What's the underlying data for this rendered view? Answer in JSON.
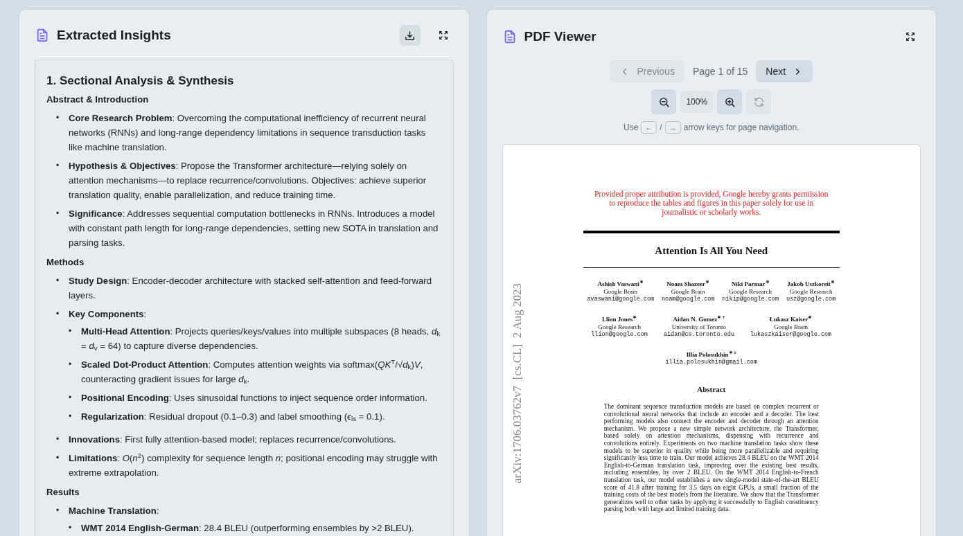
{
  "insights": {
    "title": "Extracted Insights",
    "heading": "1. Sectional Analysis & Synthesis",
    "groups": [
      {
        "title": "Abstract & Introduction",
        "items": [
          {
            "marker": "•",
            "text": "**Core Research Problem**: Overcoming the computational inefficiency of recurrent neural networks (RNNs) and long-range dependency limitations in sequence transduction tasks like machine translation."
          },
          {
            "marker": "•",
            "text": "**Hypothesis & Objectives**: Propose the Transformer architecture—relying solely on attention mechanisms—to replace recurrence/convolutions. Objectives: achieve superior translation quality, enable parallelization, and reduce training time."
          },
          {
            "marker": "•",
            "text": "**Significance**: Addresses sequential computation bottlenecks in RNNs. Introduces a model with constant path length for long-range dependencies, setting new SOTA in translation and parsing tasks."
          }
        ]
      },
      {
        "title": "Methods",
        "items": [
          {
            "marker": "•",
            "text": "**Study Design**: Encoder-decoder architecture with stacked self-attention and feed-forward layers."
          },
          {
            "marker": "•",
            "text": "**Key Components**:",
            "children": [
              {
                "marker": "•",
                "text": "**Multi-Head Attention**: Projects queries/keys/values into multiple subspaces (8 heads, *d*$_{k}$ = *d*$_{v}$ = 64) to capture diverse dependencies."
              },
              {
                "marker": "•",
                "text": "**Scaled Dot-Product Attention**: Computes attention weights via softmax(*QK*$^{T}$/√*d*$_{k}$)*V*, counteracting gradient issues for large *d*$_{k}$."
              },
              {
                "marker": "•",
                "text": "**Positional Encoding**: Uses sinusoidal functions to inject sequence order information."
              },
              {
                "marker": "•",
                "text": "**Regularization**: Residual dropout (0.1–0.3) and label smoothing (*ϵ*$_{ls}$ = 0.1)."
              }
            ]
          },
          {
            "marker": "•",
            "text": "**Innovations**: First fully attention-based model; replaces recurrence/convolutions."
          },
          {
            "marker": "•",
            "text": "**Limitations**: *O*(*n*$^{2}$) complexity for sequence length *n*; positional encoding may struggle with extreme extrapolation."
          }
        ]
      },
      {
        "title": "Results",
        "items": [
          {
            "marker": "•",
            "text": "**Machine Translation**:",
            "children": [
              {
                "marker": "•",
                "text": "**WMT 2014 English-German**: 28.4 BLEU (outperforming ensembles by >2 BLEU)."
              }
            ]
          }
        ]
      }
    ]
  },
  "viewer": {
    "title": "PDF Viewer",
    "previous": {
      "label": "Previous",
      "disabled": true
    },
    "page_indicator": "Page 1 of 15",
    "next": {
      "label": "Next",
      "disabled": false
    },
    "zoom_out": {
      "disabled": false
    },
    "zoom_level": "100%",
    "zoom_in": {
      "disabled": false
    },
    "reset": {
      "disabled": true
    },
    "hint": {
      "before": "Use",
      "keys": [
        "←",
        "→"
      ],
      "separator": "/",
      "after": "arrow keys for page navigation."
    },
    "paper": {
      "notice": "Provided proper attribution is provided, Google hereby grants permission to reproduce the tables and figures in this paper solely for use in journalistic or scholarly works.",
      "title": "Attention Is All You Need",
      "author_rows": [
        [
          {
            "name": "Ashish Vaswani$^{∗}$",
            "affiliation": "Google Brain",
            "email": "avaswani@google.com"
          },
          {
            "name": "Noam Shazeer$^{∗}$",
            "affiliation": "Google Brain",
            "email": "noam@google.com"
          },
          {
            "name": "Niki Parmar$^{∗}$",
            "affiliation": "Google Research",
            "email": "nikip@google.com"
          },
          {
            "name": "Jakob Uszkoreit$^{∗}$",
            "affiliation": "Google Research",
            "email": "usz@google.com"
          }
        ],
        [
          {
            "name": "Llion Jones$^{∗}$",
            "affiliation": "Google Research",
            "email": "llion@google.com"
          },
          {
            "name": "Aidan N. Gomez$^{∗ †}$",
            "affiliation": "University of Toronto",
            "email": "aidan@cs.toronto.edu"
          },
          {
            "name": "Łukasz Kaiser$^{∗}$",
            "affiliation": "Google Brain",
            "email": "lukaszkaiser@google.com"
          }
        ],
        [
          {
            "name": "Illia Polosukhin$^{∗ ‡}$",
            "email": "illia.polosukhin@gmail.com"
          }
        ]
      ],
      "abstract_title": "Abstract",
      "abstract": "The dominant sequence transduction models are based on complex recurrent or convolutional neural networks that include an encoder and a decoder. The best performing models also connect the encoder and decoder through an attention mechanism. We propose a new simple network architecture, the Transformer, based solely on attention mechanisms, dispensing with recurrence and convolutions entirely. Experiments on two machine translation tasks show these models to be superior in quality while being more parallelizable and requiring significantly less time to train. Our model achieves 28.4 BLEU on the WMT 2014 English-to-German translation task, improving over the existing best results, including ensembles, by over 2 BLEU. On the WMT 2014 English-to-French translation task, our model establishes a new single-model state-of-the-art BLEU score of 41.8 after training for 3.5 days on eight GPUs, a small fraction of the training costs of the best models from the literature. We show that the Transformer generalizes well to other tasks by applying it successfully to English constituency parsing both with large and limited training data.",
      "side_stamp": "arXiv:1706.03762v7  [cs.CL]  2 Aug 2023"
    }
  }
}
